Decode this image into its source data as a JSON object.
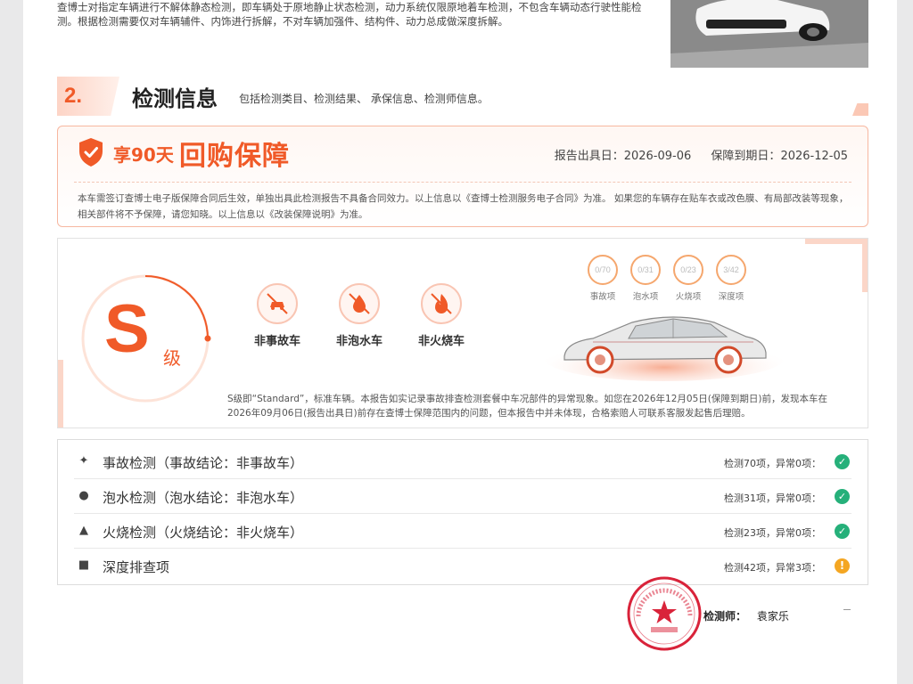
{
  "intro": {
    "text": "查博士对指定车辆进行不解体静态检测，即车辆处于原地静止状态检测，动力系统仅限原地着车检测，不包含车辆动态行驶性能检测。根据检测需要仅对车辆辅件、内饰进行拆解，不对车辆加强件、结构件、动力总成做深度拆解。"
  },
  "section": {
    "number": "2.",
    "title": "检测信息",
    "subtitle": "包括检测类目、检测结果、 承保信息、检测师信息。"
  },
  "guarantee": {
    "days_label": "享90天",
    "title": "回购保障",
    "issue_date_label": "报告出具日：",
    "issue_date": "2026-09-06",
    "expire_date_label": "保障到期日：",
    "expire_date": "2026-12-05",
    "text": "本车需签订查博士电子版保障合同后生效，单独出具此检测报告不具备合同效力。以上信息以《查博士检测服务电子合同》为准。 如果您的车辆存在贴车衣或改色膜、有局部改装等现象，相关部件将不予保障，请您知晓。以上信息以《改装保障说明》为准。"
  },
  "grade": {
    "letter": "S",
    "suffix": "级",
    "badges": [
      {
        "label": "非事故车",
        "icon": "car-crash-icon"
      },
      {
        "label": "非泡水车",
        "icon": "water-drop-icon"
      },
      {
        "label": "非火烧车",
        "icon": "flame-icon"
      }
    ],
    "mini_items": [
      {
        "count": "0/70",
        "label": "事故项"
      },
      {
        "count": "0/31",
        "label": "泡水项"
      },
      {
        "count": "0/23",
        "label": "火烧项"
      },
      {
        "count": "3/42",
        "label": "深度项"
      }
    ],
    "description": "S级即“Standard”，标准车辆。本报告如实记录事故排查检测套餐中车况部件的异常现象。如您在2026年12月05日(保障到期日)前，发现本车在2026年09月06日(报告出具日)前存在查博士保障范围内的问题，但本报告中并未体现，合格索赔人可联系客服发起售后理赔。"
  },
  "checklist": [
    {
      "icon": "car-crash-icon",
      "title": "事故检测（事故结论：非事故车）",
      "count": "检测70项，异常0项：",
      "status": "ok"
    },
    {
      "icon": "water-drop-icon",
      "title": "泡水检测（泡水结论：非泡水车）",
      "count": "检测31项，异常0项：",
      "status": "ok"
    },
    {
      "icon": "flame-icon",
      "title": "火烧检测（火烧结论：非火烧车）",
      "count": "检测23项，异常0项：",
      "status": "ok"
    },
    {
      "icon": "engine-icon",
      "title": "深度排查项",
      "count": "检测42项，异常3项：",
      "status": "warn"
    }
  ],
  "inspector": {
    "label": "检测师：",
    "name": "袁家乐"
  },
  "colors": {
    "accent": "#f05a28",
    "ok": "#26b07a",
    "warn": "#f4a622"
  }
}
